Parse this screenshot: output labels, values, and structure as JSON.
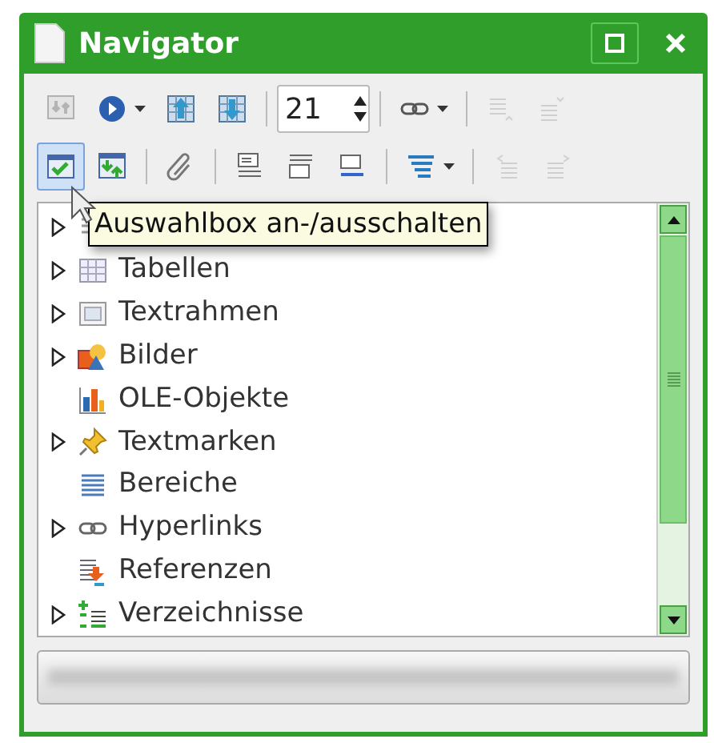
{
  "window": {
    "title": "Navigator"
  },
  "toolbar_rows": [
    [
      {
        "kind": "button",
        "disabled": true
      },
      {
        "kind": "button",
        "disabled": false,
        "dropdown": true
      },
      {
        "kind": "button",
        "disabled": false
      },
      {
        "kind": "button",
        "disabled": false
      },
      {
        "kind": "separator"
      },
      {
        "kind": "spin",
        "value": "21"
      },
      {
        "kind": "separator"
      },
      {
        "kind": "button",
        "disabled": false,
        "dropdown": true
      },
      {
        "kind": "separator"
      },
      {
        "kind": "button",
        "disabled": true
      },
      {
        "kind": "button",
        "disabled": true
      }
    ],
    [
      {
        "kind": "button",
        "disabled": false,
        "selected": true
      },
      {
        "kind": "button",
        "disabled": false,
        "selected": false
      },
      {
        "kind": "separator"
      },
      {
        "kind": "button",
        "disabled": false,
        "selected": false
      },
      {
        "kind": "separator"
      },
      {
        "kind": "button",
        "disabled": false,
        "selected": false
      },
      {
        "kind": "button",
        "disabled": false,
        "selected": false
      },
      {
        "kind": "button",
        "disabled": false,
        "selected": false
      },
      {
        "kind": "separator"
      },
      {
        "kind": "button",
        "disabled": false,
        "selected": false,
        "dropdown": true
      },
      {
        "kind": "separator"
      },
      {
        "kind": "button",
        "disabled": true,
        "selected": false
      },
      {
        "kind": "button",
        "disabled": true,
        "selected": false
      }
    ]
  ],
  "tooltip": "Auswahlbox an-/ausschalten",
  "tree": [
    {
      "expandable": true
    },
    {
      "label": "Tabellen",
      "expandable": true
    },
    {
      "label": "Textrahmen",
      "expandable": true
    },
    {
      "label": "Bilder",
      "expandable": true
    },
    {
      "label": "OLE-Objekte",
      "expandable": false
    },
    {
      "label": "Textmarken",
      "expandable": true
    },
    {
      "label": "Bereiche",
      "expandable": false
    },
    {
      "label": "Hyperlinks",
      "expandable": true
    },
    {
      "label": "Referenzen",
      "expandable": false
    },
    {
      "label": "Verzeichnisse",
      "expandable": true
    }
  ]
}
